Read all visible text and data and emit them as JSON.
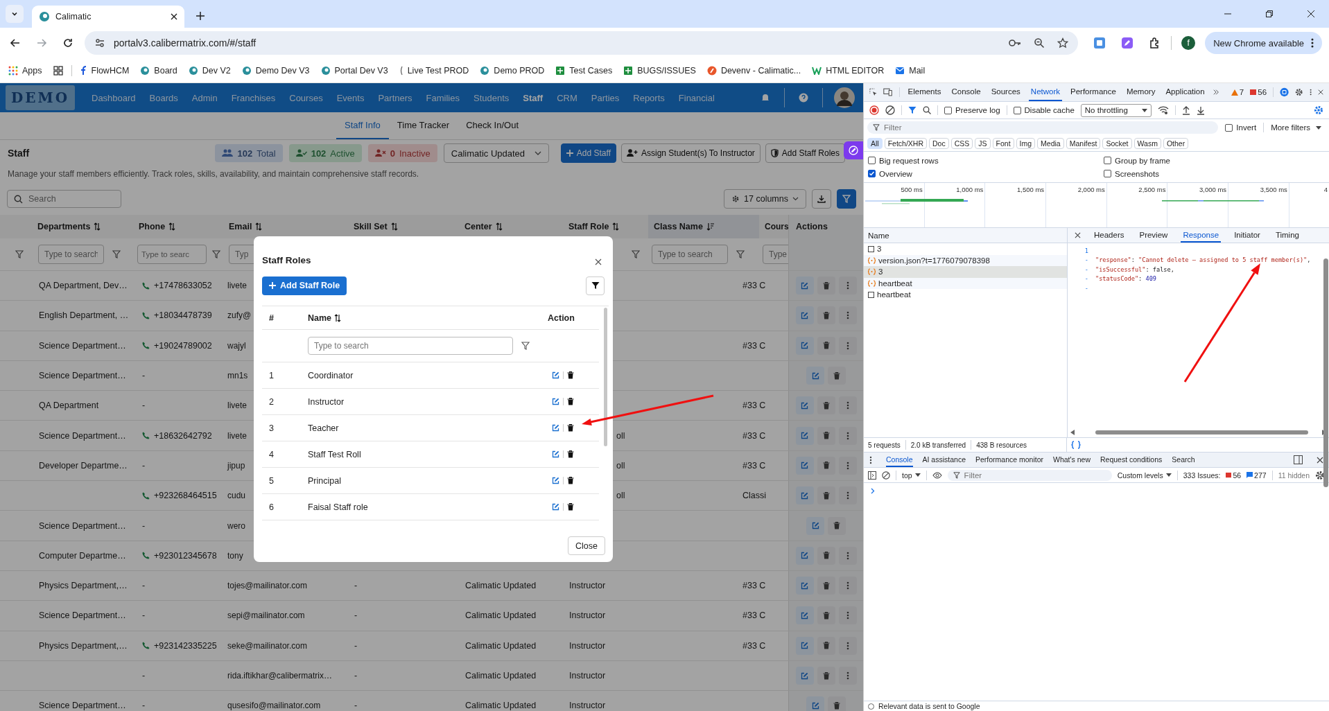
{
  "browser": {
    "tab": {
      "title": "Calimatic"
    },
    "url": "portalv3.calibermatrix.com/#/staff",
    "profile": "f",
    "update_button": "New Chrome available",
    "bookmarks": [
      {
        "label": "Apps",
        "kind": "apps"
      },
      {
        "label": "FlowHCM",
        "kind": "flow"
      },
      {
        "label": "Board",
        "kind": "calimatic"
      },
      {
        "label": "Dev V2",
        "kind": "calimatic"
      },
      {
        "label": "Demo Dev V3",
        "kind": "calimatic"
      },
      {
        "label": "Portal Dev V3",
        "kind": "calimatic"
      },
      {
        "label": "Live Test PROD",
        "kind": "live"
      },
      {
        "label": "Demo PROD",
        "kind": "calimatic"
      },
      {
        "label": "Test Cases",
        "kind": "sheet"
      },
      {
        "label": "BUGS/ISSUES",
        "kind": "sheet"
      },
      {
        "label": "Devenv - Calimatic...",
        "kind": "devenv"
      },
      {
        "label": "HTML EDITOR",
        "kind": "html"
      },
      {
        "label": "Mail",
        "kind": "mail"
      }
    ]
  },
  "app": {
    "logo": "DEMO",
    "nav": [
      {
        "label": "Dashboard",
        "selected": false
      },
      {
        "label": "Boards",
        "selected": false
      },
      {
        "label": "Admin",
        "selected": false
      },
      {
        "label": "Franchises",
        "selected": false
      },
      {
        "label": "Courses",
        "selected": false
      },
      {
        "label": "Events",
        "selected": false
      },
      {
        "label": "Partners",
        "selected": false
      },
      {
        "label": "Families",
        "selected": false
      },
      {
        "label": "Students",
        "selected": false
      },
      {
        "label": "Staff",
        "selected": true
      },
      {
        "label": "CRM",
        "selected": false
      },
      {
        "label": "Parties",
        "selected": false
      },
      {
        "label": "Reports",
        "selected": false
      },
      {
        "label": "Financial",
        "selected": false
      }
    ],
    "subtabs": [
      {
        "label": "Staff Info",
        "selected": true
      },
      {
        "label": "Time Tracker",
        "selected": false
      },
      {
        "label": "Check In/Out",
        "selected": false
      }
    ],
    "title": "Staff",
    "stats": [
      {
        "count": "102",
        "label": "Total",
        "kind": "total"
      },
      {
        "count": "102",
        "label": "Active",
        "kind": "active"
      },
      {
        "count": "0",
        "label": "Inactive",
        "kind": "inactive"
      }
    ],
    "center_select": "Calimatic Updated",
    "actions": [
      {
        "label": "Add Staff",
        "kind": "primary"
      },
      {
        "label": "Assign Student(s) To Instructor",
        "kind": "assign"
      },
      {
        "label": "Add Staff Roles",
        "kind": "roles"
      }
    ],
    "description": "Manage your staff members efficiently. Track roles, skills, availability, and maintain comprehensive staff records.",
    "search": {
      "placeholder": "Search"
    },
    "columns_button": "17 columns",
    "table": {
      "columns": [
        {
          "label": "Departments",
          "kind": "sortable"
        },
        {
          "label": "Phone",
          "kind": "sortable"
        },
        {
          "label": "Email",
          "kind": "sortable"
        },
        {
          "label": "Skill Set",
          "kind": "sortable"
        },
        {
          "label": "Center",
          "kind": "sortable"
        },
        {
          "label": "Staff Role",
          "kind": "sortable"
        },
        {
          "label": "Class Name",
          "kind": "sorted"
        },
        {
          "label": "Cours",
          "kind": "plain"
        },
        {
          "label": "Actions",
          "kind": "plain"
        }
      ],
      "filters": [
        {
          "kind": "field",
          "placeholder": "Type to search"
        },
        {
          "kind": "field",
          "placeholder": "Type to searc"
        },
        {
          "kind": "field",
          "placeholder": "Typ"
        },
        {
          "kind": "covered"
        },
        {
          "kind": "covered"
        },
        {
          "kind": "tail"
        },
        {
          "kind": "field",
          "placeholder": "Type to search"
        },
        {
          "kind": "field",
          "placeholder": "Type"
        }
      ],
      "rows": [
        {
          "department": "QA Department, Dev…",
          "callable": true,
          "phone": "+17478633052",
          "email": "livete",
          "course": "#33 C",
          "more": true
        },
        {
          "department": "English Department, …",
          "callable": true,
          "phone": "+18034478739",
          "email": "zufy@",
          "more": true
        },
        {
          "department": "Science Department…",
          "callable": true,
          "phone": "+19024789002",
          "email": "wajyl",
          "course": "#33 C",
          "more": true
        },
        {
          "department": "Science Department…",
          "callable": false,
          "phone": "-",
          "email": "mn1s",
          "more": false
        },
        {
          "department": "QA Department",
          "callable": false,
          "phone": "-",
          "email": "livete",
          "course": "#33 C",
          "more": true
        },
        {
          "department": "Science Department…",
          "callable": true,
          "phone": "+18632642792",
          "email": "livete",
          "staff_role": "oll",
          "course": "#33 C",
          "more": true
        },
        {
          "department": "Developer Departme…",
          "callable": false,
          "phone": "-",
          "email": "jipup",
          "staff_role": "oll",
          "course": "#33 C",
          "more": true
        },
        {
          "callable": true,
          "phone": "+923268464515",
          "email": "cudu",
          "staff_role": "oll",
          "course": "Classi",
          "more": true
        },
        {
          "department": "Science Department…",
          "callable": false,
          "phone": "-",
          "email": "wero",
          "more": false
        },
        {
          "department": "Computer Departme…",
          "callable": true,
          "phone": "+923012345678",
          "email": "tony",
          "more": true
        },
        {
          "department": "Physics Department,…",
          "callable": false,
          "phone": "-",
          "email": "tojes@mailinator.com",
          "skill_set": "-",
          "center": "Calimatic Updated",
          "staff_role": "Instructor",
          "course": "#33 C",
          "more": true
        },
        {
          "department": "Science Department…",
          "callable": false,
          "phone": "-",
          "email": "sepi@mailinator.com",
          "skill_set": "-",
          "center": "Calimatic Updated",
          "staff_role": "Instructor",
          "course": "#33 C",
          "more": true
        },
        {
          "department": "Physics Department,…",
          "callable": true,
          "phone": "+923142335225",
          "email": "seke@mailinator.com",
          "skill_set": "-",
          "center": "Calimatic Updated",
          "staff_role": "Instructor",
          "course": "#33 C",
          "more": true
        },
        {
          "callable": false,
          "phone": "-",
          "email": "rida.iftikhar@calibermatrix…",
          "skill_set": "-",
          "center": "Calimatic Updated",
          "staff_role": "Instructor",
          "more": true
        },
        {
          "department": "Science Department…",
          "callable": false,
          "phone": "-",
          "email": "qusesifo@mailinator.com",
          "skill_set": "-",
          "center": "Calimatic Updated",
          "staff_role": "Instructor",
          "more": false
        }
      ]
    }
  },
  "modal": {
    "title": "Staff Roles",
    "add_button": "Add Staff Role",
    "columns": [
      "#",
      "Name",
      "Action"
    ],
    "search_placeholder": "Type to search",
    "roles": [
      {
        "number": "1",
        "name": "Coordinator"
      },
      {
        "number": "2",
        "name": "Instructor"
      },
      {
        "number": "3",
        "name": "Teacher"
      },
      {
        "number": "4",
        "name": "Staff Test Roll"
      },
      {
        "number": "5",
        "name": "Principal"
      },
      {
        "number": "6",
        "name": "Faisal Staff role"
      }
    ],
    "close_button": "Close"
  },
  "devtools": {
    "tabs": [
      {
        "label": "Elements",
        "selected": false
      },
      {
        "label": "Console",
        "selected": false
      },
      {
        "label": "Sources",
        "selected": false
      },
      {
        "label": "Network",
        "selected": true
      },
      {
        "label": "Performance",
        "selected": false
      },
      {
        "label": "Memory",
        "selected": false
      },
      {
        "label": "Application",
        "selected": false
      }
    ],
    "warnings": "7",
    "errors": "56",
    "preserve_log": {
      "label": "Preserve log",
      "checked": false
    },
    "disable_cache": {
      "label": "Disable cache",
      "checked": false
    },
    "throttling": "No throttling",
    "filter": {
      "placeholder": "Filter"
    },
    "invert": {
      "label": "Invert",
      "checked": false
    },
    "more_filters": "More filters",
    "types": [
      {
        "label": "All",
        "selected": true
      },
      {
        "label": "Fetch/XHR",
        "selected": false
      },
      {
        "label": "Doc",
        "selected": false
      },
      {
        "label": "CSS",
        "selected": false
      },
      {
        "label": "JS",
        "selected": false
      },
      {
        "label": "Font",
        "selected": false
      },
      {
        "label": "Img",
        "selected": false
      },
      {
        "label": "Media",
        "selected": false
      },
      {
        "label": "Manifest",
        "selected": false
      },
      {
        "label": "Socket",
        "selected": false
      },
      {
        "label": "Wasm",
        "selected": false
      },
      {
        "label": "Other",
        "selected": false
      }
    ],
    "options": [
      {
        "label": "Big request rows",
        "checked": false
      },
      {
        "label": "Group by frame",
        "checked": false
      },
      {
        "label": "Overview",
        "checked": true
      },
      {
        "label": "Screenshots",
        "checked": false
      }
    ],
    "ticks": [
      "500 ms",
      "1,000 ms",
      "1,500 ms",
      "2,000 ms",
      "2,500 ms",
      "3,000 ms",
      "3,500 ms",
      "4"
    ],
    "name_header": "Name",
    "requests": [
      {
        "name": "3",
        "kind": "doc",
        "selected": false
      },
      {
        "name": "version.json?t=1776079078398",
        "kind": "xhr",
        "selected": false
      },
      {
        "name": "3",
        "kind": "xhr",
        "selected": true
      },
      {
        "name": "heartbeat",
        "kind": "xhr",
        "selected": false
      },
      {
        "name": "heartbeat",
        "kind": "doc",
        "selected": false
      }
    ],
    "detail_tabs": [
      {
        "label": "Headers",
        "selected": false
      },
      {
        "label": "Preview",
        "selected": false
      },
      {
        "label": "Response",
        "selected": true
      },
      {
        "label": "Initiator",
        "selected": false
      },
      {
        "label": "Timing",
        "selected": false
      }
    ],
    "response": [
      {
        "gutter": "1"
      },
      {
        "gutter": "-",
        "tokens": [
          {
            "text": "\"response\"",
            "kind": "key"
          },
          {
            "text": ": ",
            "kind": "plain"
          },
          {
            "text": "\"Cannot delete – assigned to 5 staff member(s)\"",
            "kind": "string"
          },
          {
            "text": ",",
            "kind": "plain"
          }
        ]
      },
      {
        "gutter": "-",
        "tokens": [
          {
            "text": "\"isSuccessful\"",
            "kind": "key"
          },
          {
            "text": ": ",
            "kind": "plain"
          },
          {
            "text": "false",
            "kind": "keyword"
          },
          {
            "text": ",",
            "kind": "plain"
          }
        ]
      },
      {
        "gutter": "-",
        "tokens": [
          {
            "text": "\"statusCode\"",
            "kind": "key"
          },
          {
            "text": ": ",
            "kind": "plain"
          },
          {
            "text": "409",
            "kind": "number"
          }
        ]
      },
      {
        "gutter": "-"
      }
    ],
    "summary": [
      "5 requests",
      "2.0 kB transferred",
      "438 B resources"
    ],
    "drawer_tabs": [
      {
        "label": "Console",
        "selected": true
      },
      {
        "label": "AI assistance",
        "selected": false
      },
      {
        "label": "Performance monitor",
        "selected": false
      },
      {
        "label": "What's new",
        "selected": false
      },
      {
        "label": "Request conditions",
        "selected": false
      },
      {
        "label": "Search",
        "selected": false
      }
    ],
    "context": "top",
    "console_filter": {
      "placeholder": "Filter"
    },
    "levels": "Custom levels",
    "issues_label": "333 Issues:",
    "issue_errors": "56",
    "issue_info": "277",
    "hidden": "11 hidden",
    "footer": "Relevant data is sent to Google"
  }
}
